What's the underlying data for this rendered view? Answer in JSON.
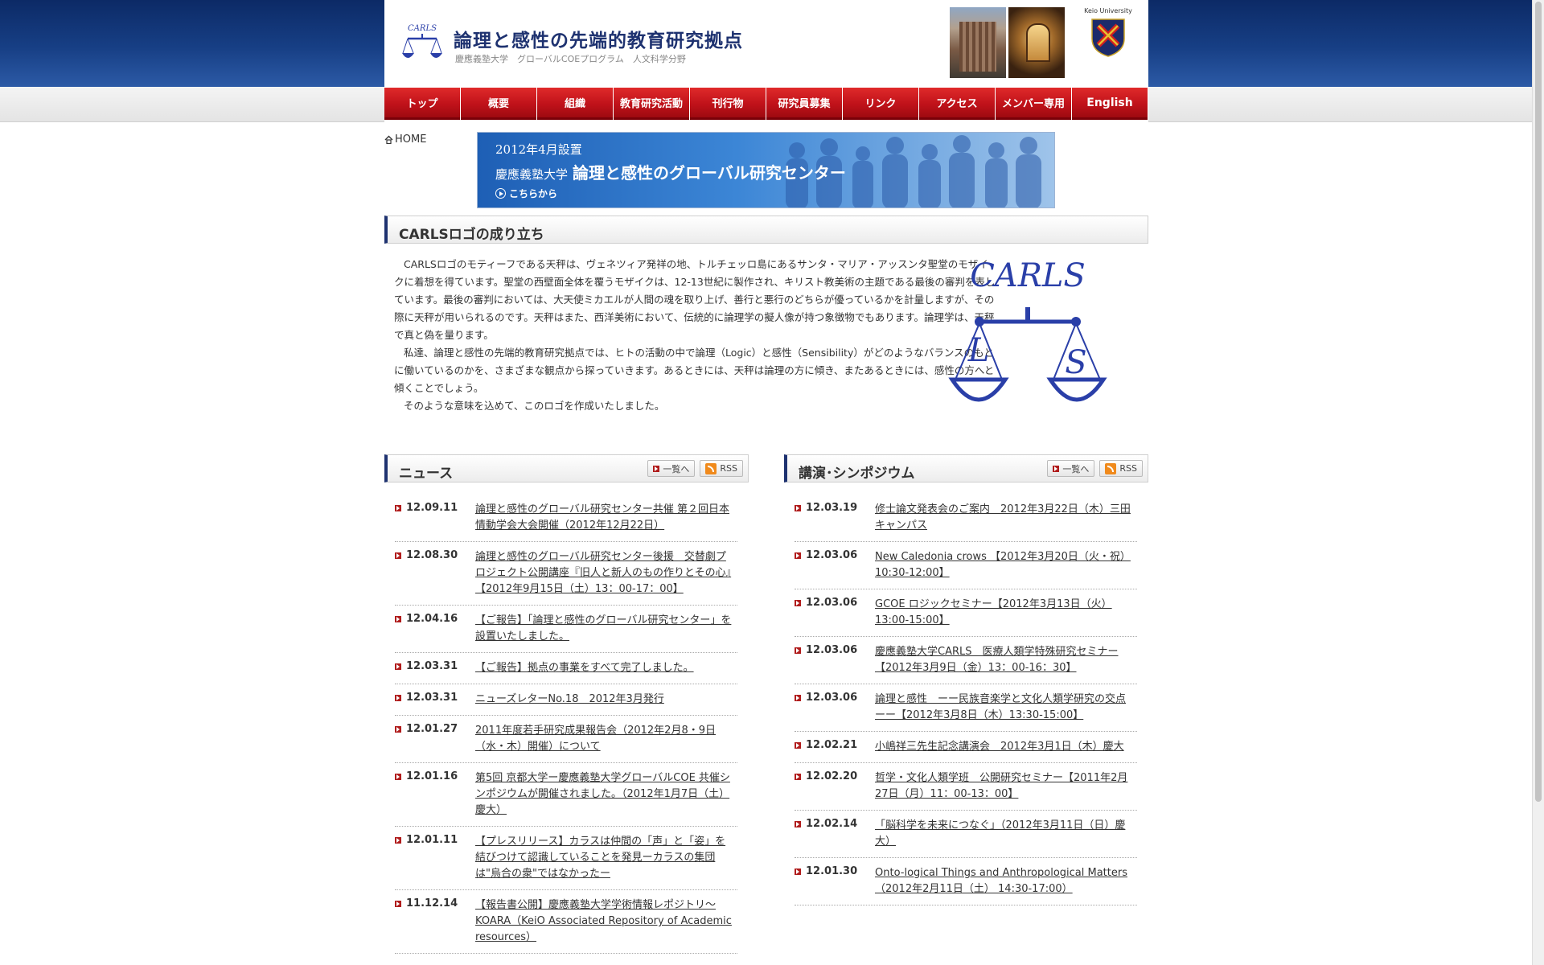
{
  "header": {
    "title": "論理と感性の先端的教育研究拠点",
    "subtitle": "慶應義塾大学　グローバルCOEプログラム　人文科学分野",
    "logo_text": "CARLS",
    "keio_label": "Keio University"
  },
  "nav": {
    "items": [
      "トップ",
      "概要",
      "組織",
      "教育研究活動",
      "刊行物",
      "研究員募集",
      "リンク",
      "アクセス",
      "メンバー専用",
      "English"
    ]
  },
  "breadcrumb": {
    "home": "HOME"
  },
  "banner": {
    "line1": "2012年4月設置",
    "line2_small": "慶應義塾大学",
    "line2": "論理と感性のグローバル研究センター",
    "line3": "こちらから"
  },
  "about": {
    "heading": "CARLSロゴの成り立ち",
    "paragraphs": [
      "CARLSロゴのモティーフである天秤は、ヴェネツィア発祥の地、トルチェッロ島にあるサンタ・マリア・アッスンタ聖堂のモザイクに着想を得ています。聖堂の西壁面全体を覆うモザイクは、12-13世紀に製作され、キリスト教美術の主題である最後の審判を表しています。最後の審判においては、大天使ミカエルが人間の魂を取り上げ、善行と悪行のどちらが優っているかを計量しますが、その際に天秤が用いられるのです。天秤はまた、西洋美術において、伝統的に論理学の擬人像が持つ象徴物でもあります。論理学は、天秤で真と偽を量ります。",
      "私達、論理と感性の先端的教育研究拠点では、ヒトの活動の中で論理（Logic）と感性（Sensibility）がどのようなバランスのもとに働いているのかを、さまざまな観点から探っていきます。あるときには、天秤は論理の方に傾き、またあるときには、感性の方へと傾くことでしょう。",
      "そのような意味を込めて、このロゴを作成いたしました。"
    ],
    "logo_word": "CARLS",
    "logo_left": "L",
    "logo_right": "S"
  },
  "news": {
    "heading": "ニュース",
    "list_btn": "一覧へ",
    "rss_btn": "RSS",
    "items": [
      {
        "date": "12.09.11",
        "text": "論理と感性のグローバル研究センター共催 第２回日本情動学会大会開催（2012年12月22日）"
      },
      {
        "date": "12.08.30",
        "text": "論理と感性のグローバル研究センター後援　交替劇プロジェクト公開講座『旧人と新人のもの作りとその心』【2012年9月15日（土）13：00-17：00】"
      },
      {
        "date": "12.04.16",
        "text": "【ご報告】「論理と感性のグローバル研究センター」を設置いたしました。"
      },
      {
        "date": "12.03.31",
        "text": "【ご報告】拠点の事業をすべて完了しました。"
      },
      {
        "date": "12.03.31",
        "text": "ニューズレターNo.18　2012年3月発行"
      },
      {
        "date": "12.01.27",
        "text": "2011年度若手研究成果報告会（2012年2月8・9日（水・木）開催）について"
      },
      {
        "date": "12.01.16",
        "text": "第5回 京都大学ー慶應義塾大学グローバルCOE 共催シンポジウムが開催されました。（2012年1月7日（土）慶大）"
      },
      {
        "date": "12.01.11",
        "text": "【プレスリリース】カラスは仲間の「声」と「姿」を結びつけて認識していることを発見ーカラスの集団は\"烏合の衆\"ではなかったー"
      },
      {
        "date": "11.12.14",
        "text": "【報告書公開】慶應義塾大学学術情報レポジトリ〜KOARA（KeiO Associated Repository of Academic resources）"
      }
    ]
  },
  "lectures": {
    "heading": "講演･シンポジウム",
    "list_btn": "一覧へ",
    "rss_btn": "RSS",
    "items": [
      {
        "date": "12.03.19",
        "text": "修士論文発表会のご案内　2012年3月22日（木）三田キャンパス"
      },
      {
        "date": "12.03.06",
        "text": "New Caledonia crows 【2012年3月20日（火・祝）10:30-12:00】"
      },
      {
        "date": "12.03.06",
        "text": "GCOE ロジックセミナー【2012年3月13日（火）13:00-15:00】"
      },
      {
        "date": "12.03.06",
        "text": "慶應義塾大学CARLS　医療人類学特殊研究セミナー【2012年3月9日（金）13：00-16：30】"
      },
      {
        "date": "12.03.06",
        "text": "論理と感性　ーー民族音楽学と文化人類学研究の交点ーー【2012年3月8日（木）13:30-15:00】"
      },
      {
        "date": "12.02.21",
        "text": "小嶋祥三先生記念講演会　2012年3月1日（木）慶大"
      },
      {
        "date": "12.02.20",
        "text": "哲学・文化人類学班　公開研究セミナー【2011年2月27日（月）11：00-13：00】"
      },
      {
        "date": "12.02.14",
        "text": "「脳科学を未来につなぐ」（2012年3月11日（日）慶大）"
      },
      {
        "date": "12.01.30",
        "text": "Onto-logical Things and Anthropological Matters （2012年2月11日（土） 14:30-17:00）"
      }
    ]
  },
  "colors": {
    "nav_red": "#c0121a",
    "header_blue": "#173f85",
    "title_navy": "#1e3270",
    "logo_blue": "#2a3fa8"
  }
}
